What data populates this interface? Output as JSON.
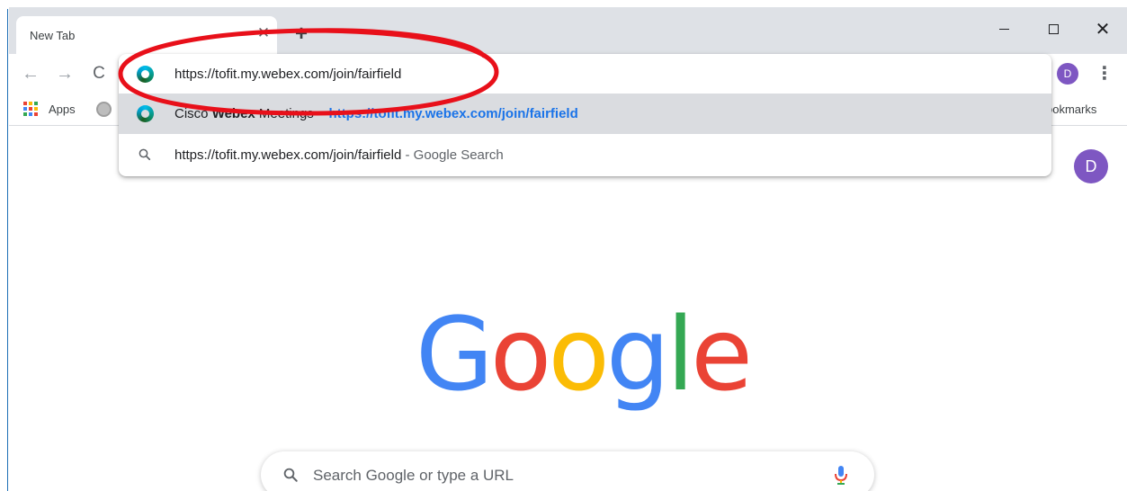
{
  "tab": {
    "title": "New Tab",
    "close_glyph": "✕",
    "new_tab_glyph": "+"
  },
  "window_controls": {
    "close_glyph": "✕"
  },
  "toolbar": {
    "back_glyph": "←",
    "forward_glyph": "→",
    "reload_glyph": "C",
    "avatar_initial": "D",
    "menu_glyph": "⋮"
  },
  "bookmarks": {
    "apps_label": "Apps",
    "other_label": "ookmarks",
    "apps_colors": [
      "#ea4335",
      "#fbbc05",
      "#34a853",
      "#4285f4",
      "#ea4335",
      "#fbbc05",
      "#34a853",
      "#4285f4",
      "#ea4335"
    ]
  },
  "omnibox": {
    "input_value": "https://tofit.my.webex.com/join/fairfield",
    "suggestion1": {
      "prefix": "Cisco ",
      "bold": "Webex",
      "rest": " Meetings",
      "separator": " – ",
      "url": "https://tofit.my.webex.com/join/fairfield"
    },
    "suggestion2": {
      "text": "https://tofit.my.webex.com/join/fairfield",
      "separator": " - ",
      "source": "Google Search"
    }
  },
  "page": {
    "avatar_initial": "D",
    "logo": {
      "G": "G",
      "o1": "o",
      "o2": "o",
      "g": "g",
      "l": "l",
      "e": "e"
    },
    "search_placeholder": "Search Google or type a URL"
  },
  "colors": {
    "annotation": "#e8101a",
    "google_blue": "#4285f4",
    "google_red": "#ea4335",
    "google_yellow": "#fbbc05",
    "google_green": "#34a853",
    "avatar": "#7e57c2",
    "link_blue": "#1a73e8"
  }
}
